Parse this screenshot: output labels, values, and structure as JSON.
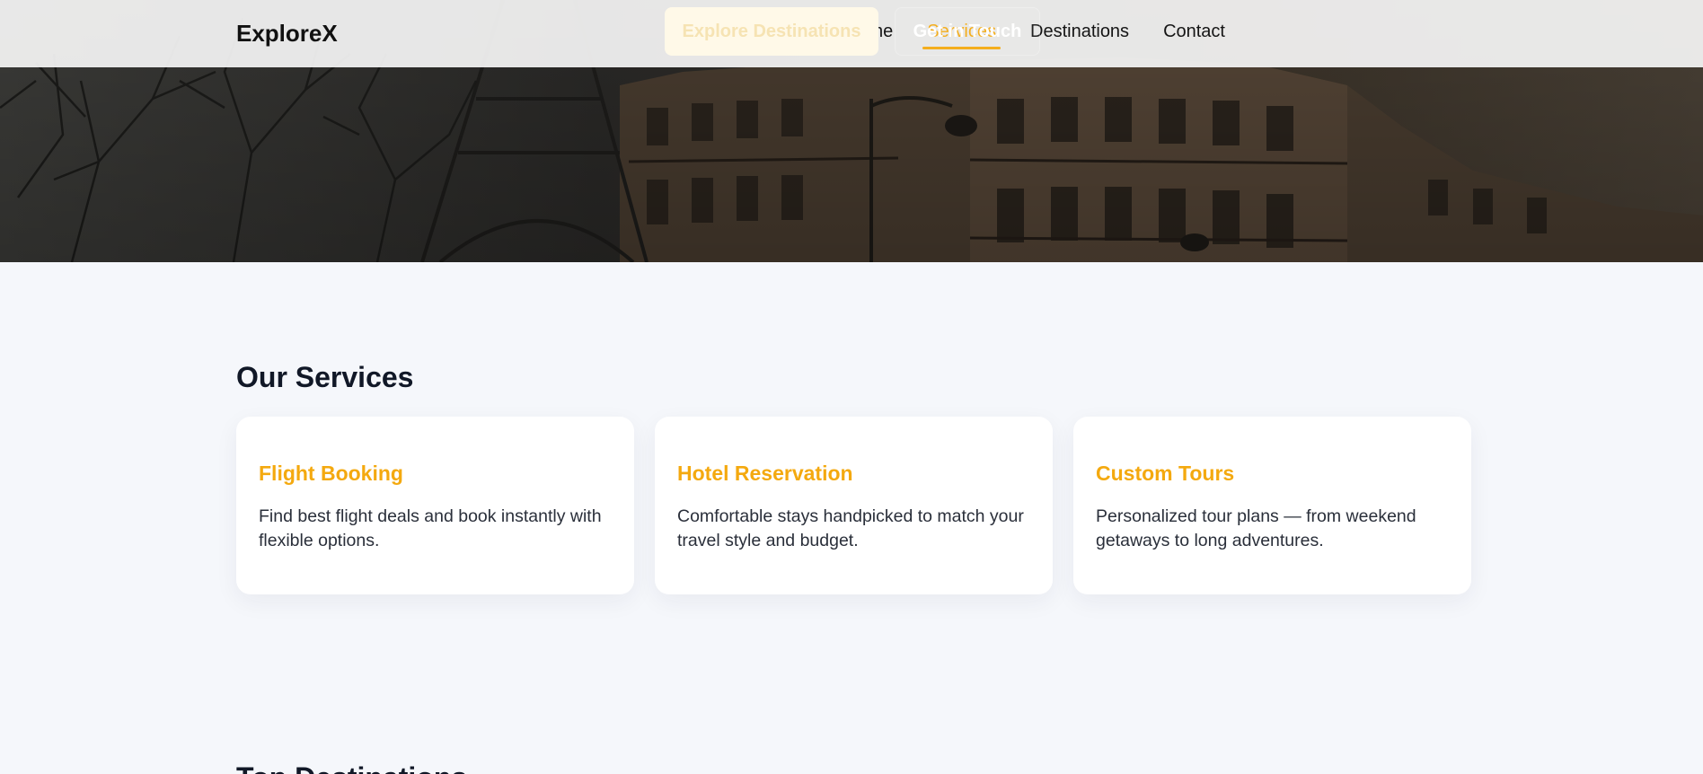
{
  "brand": {
    "name": "ExploreX"
  },
  "nav": {
    "items": [
      {
        "label": "Home",
        "active": false
      },
      {
        "label": "Services",
        "active": true
      },
      {
        "label": "Destinations",
        "active": false
      },
      {
        "label": "Contact",
        "active": false
      }
    ],
    "accent_color": "#f4a90f"
  },
  "hero": {
    "primary_button": "Explore Destinations",
    "secondary_button": "Get in Touch"
  },
  "services": {
    "title": "Our Services",
    "cards": [
      {
        "title": "Flight Booking",
        "text": "Find best flight deals and book instantly with flexible options."
      },
      {
        "title": "Hotel Reservation",
        "text": "Comfortable stays handpicked to match your travel style and budget."
      },
      {
        "title": "Custom Tours",
        "text": "Personalized tour plans — from weekend getaways to long adventures."
      }
    ]
  },
  "next_section": {
    "title": "Top Destinations"
  }
}
